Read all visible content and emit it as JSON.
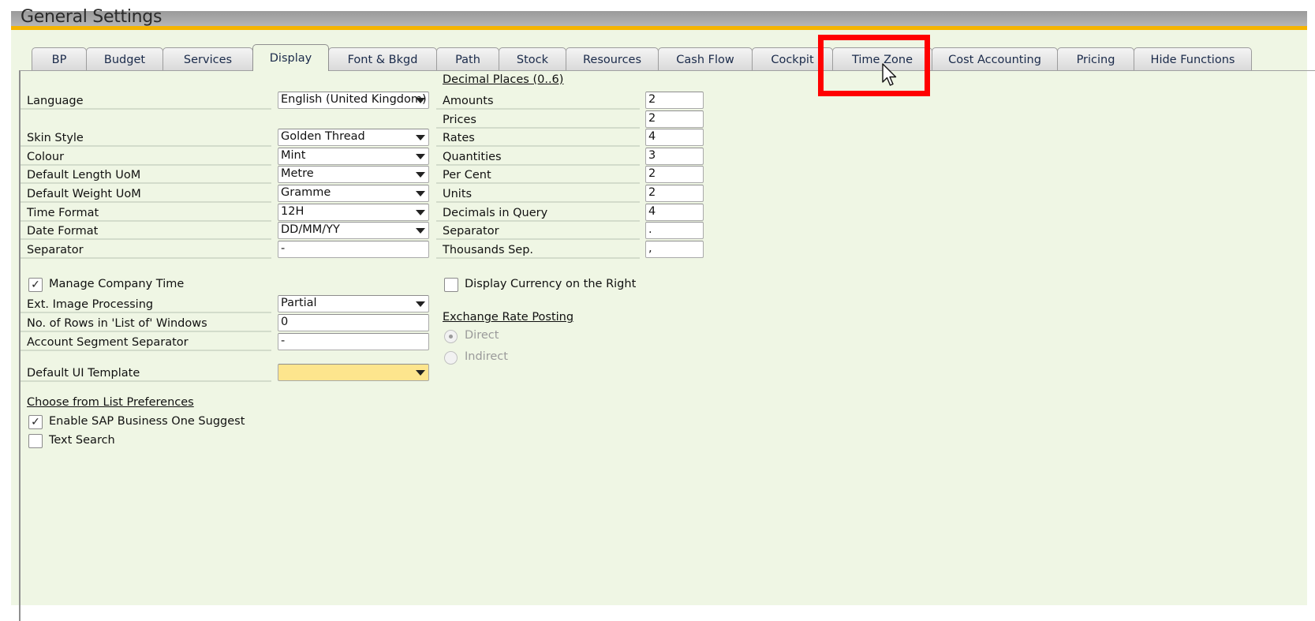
{
  "window": {
    "title": "General Settings"
  },
  "tabs": [
    {
      "label": "BP",
      "mnemonic": "P",
      "active": false
    },
    {
      "label": "Budget",
      "mnemonic": "u",
      "active": false
    },
    {
      "label": "Services",
      "mnemonic": "r",
      "active": false
    },
    {
      "label": "Display",
      "mnemonic": "i",
      "active": true
    },
    {
      "label": "Font & Bkgd",
      "mnemonic": "n",
      "active": false
    },
    {
      "label": "Path",
      "mnemonic": "a",
      "active": false
    },
    {
      "label": "Stock",
      "mnemonic": "S",
      "active": false
    },
    {
      "label": "Resources",
      "mnemonic": "",
      "active": false
    },
    {
      "label": "Cash Flow",
      "mnemonic": "C",
      "active": false
    },
    {
      "label": "Cockpit",
      "mnemonic": "k",
      "active": false
    },
    {
      "label": "Time Zone",
      "mnemonic": "Z",
      "active": false,
      "highlighted": true
    },
    {
      "label": "Cost Accounting",
      "mnemonic": "",
      "active": false
    },
    {
      "label": "Pricing",
      "mnemonic": "",
      "active": false
    },
    {
      "label": "Hide Functions",
      "mnemonic": "",
      "active": false
    }
  ],
  "left": {
    "language": {
      "label": "Language",
      "value": "English (United Kingdom)"
    },
    "skin_style": {
      "label": "Skin Style",
      "value": "Golden Thread"
    },
    "colour": {
      "label": "Colour",
      "value": "Mint"
    },
    "length_uom": {
      "label": "Default Length UoM",
      "value": "Metre"
    },
    "weight_uom": {
      "label": "Default Weight UoM",
      "value": "Gramme"
    },
    "time_format": {
      "label": "Time Format",
      "value": "12H"
    },
    "date_format": {
      "label": "Date Format",
      "value": "DD/MM/YY"
    },
    "separator": {
      "label": "Separator",
      "value": "-"
    },
    "manage_company_time": {
      "label": "Manage Company Time",
      "checked": true
    },
    "ext_image": {
      "label": "Ext. Image Processing",
      "value": "Partial"
    },
    "rows_list": {
      "label": "No. of Rows in 'List of' Windows",
      "value": "0"
    },
    "segment_sep": {
      "label": "Account Segment Separator",
      "value": "-"
    },
    "ui_template": {
      "label": "Default UI Template",
      "value": ""
    },
    "cfl_section": "Choose from List Preferences",
    "enable_suggest": {
      "label": "Enable SAP Business One Suggest",
      "checked": true
    },
    "text_search": {
      "label": "Text Search",
      "checked": false
    }
  },
  "right": {
    "decimal_section": "Decimal Places  (0..6)",
    "amounts": {
      "label": "Amounts",
      "value": "2"
    },
    "prices": {
      "label": "Prices",
      "value": "2"
    },
    "rates": {
      "label": "Rates",
      "value": "4"
    },
    "quantities": {
      "label": "Quantities",
      "value": "3"
    },
    "per_cent": {
      "label": "Per Cent",
      "value": "2"
    },
    "units": {
      "label": "Units",
      "value": "2"
    },
    "decimals_query": {
      "label": "Decimals in Query",
      "value": "4"
    },
    "separator": {
      "label": "Separator",
      "value": "."
    },
    "thousands_sep": {
      "label": "Thousands Sep.",
      "value": ","
    },
    "currency_right": {
      "label": "Display Currency on the Right",
      "checked": false
    },
    "exchange_section": "Exchange Rate Posting",
    "direct": {
      "label": "Direct",
      "selected": true
    },
    "indirect": {
      "label": "Indirect",
      "selected": false
    }
  },
  "colors": {
    "background": "#eff6e4",
    "accent_bar": "#f5b400",
    "highlight": "#ff0000",
    "template_field": "#fde58d"
  }
}
